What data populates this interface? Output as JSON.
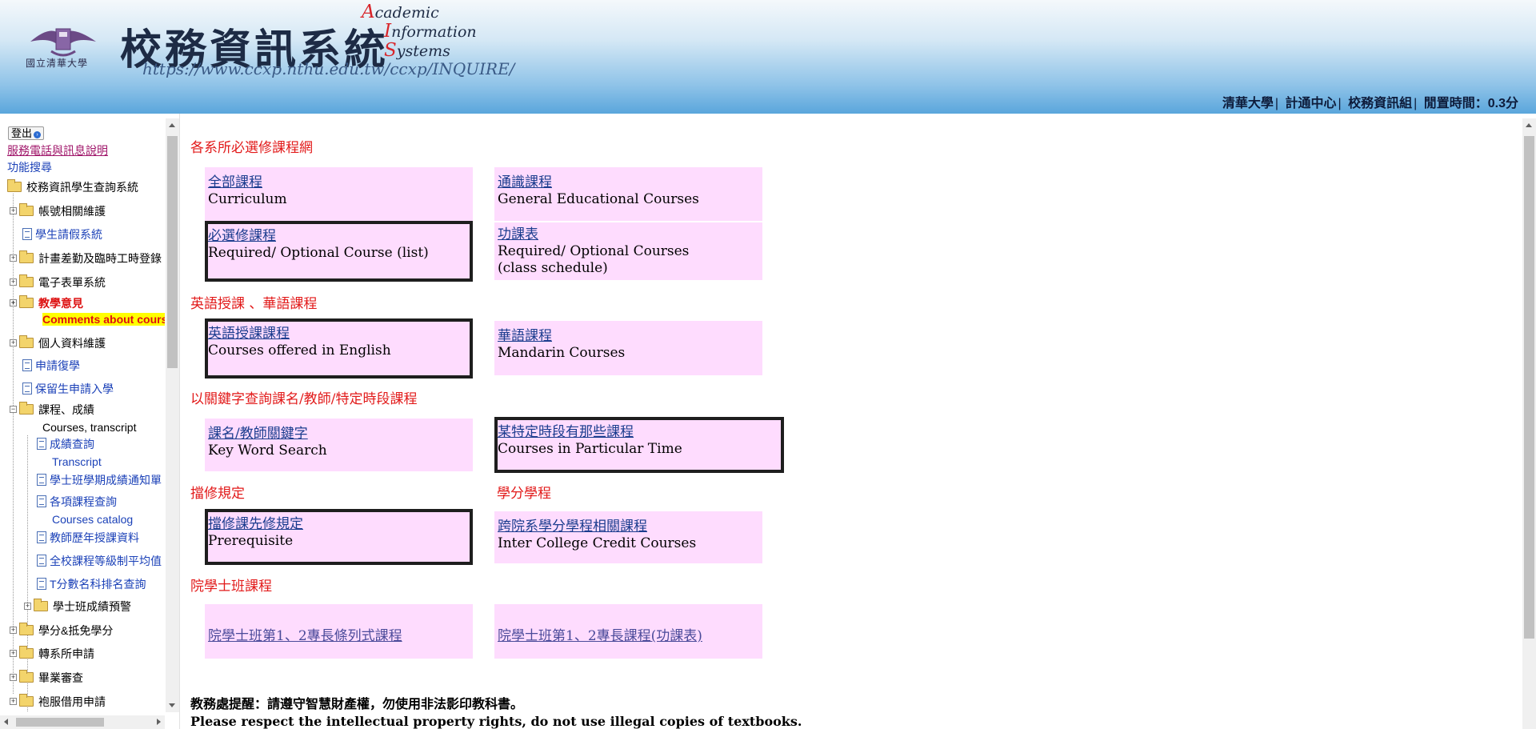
{
  "header": {
    "logo_text": "國立清華大學",
    "title_cn": "校務資訊系統",
    "title_en_lines": [
      {
        "initial": "A",
        "rest": "cademic"
      },
      {
        "initial": "I",
        "rest": "nformation"
      },
      {
        "initial": "S",
        "rest": "ystems"
      }
    ],
    "url": "https://www.ccxp.nthu.edu.tw/ccxp/INQUIRE/",
    "top_links": [
      "清華大學",
      "計通中心",
      "校務資訊組"
    ],
    "idle_label": "閒置時間：0.3分"
  },
  "sidebar": {
    "logout_label": "登出",
    "service_link": "服務電話與訊息說明",
    "search_link": "功能搜尋",
    "root_label": "校務資訊學生查詢系統",
    "items": [
      {
        "label": "帳號相關維護"
      },
      {
        "label": "學生請假系統"
      },
      {
        "label": "計畫差勤及臨時工時登錄"
      },
      {
        "label": "電子表單系統"
      },
      {
        "label": "教學意見",
        "sub": "Comments about courses"
      },
      {
        "label": "個人資料維護"
      },
      {
        "label": "申請復學"
      },
      {
        "label": "保留生申請入學"
      },
      {
        "label": "課程、成績",
        "sub": "Courses, transcript"
      },
      {
        "label": "成績查詢",
        "sub": "Transcript"
      },
      {
        "label": "學士班學期成績通知單"
      },
      {
        "label": "各項課程查詢",
        "sub": "Courses catalog"
      },
      {
        "label": "教師歷年授課資料"
      },
      {
        "label": "全校課程等級制平均值"
      },
      {
        "label": "T分數名科排名查詢"
      },
      {
        "label": "學士班成績預警"
      },
      {
        "label": "學分&抵免學分"
      },
      {
        "label": "轉系所申請"
      },
      {
        "label": "畢業審查"
      },
      {
        "label": "袍服借用申請"
      }
    ]
  },
  "main": {
    "sections": [
      "各系所必選修課程網",
      "英語授課 、華語課程",
      "以關鍵字查詢課名/教師/特定時段課程",
      "擋修規定",
      "學分學程",
      "院學士班課程"
    ],
    "cards": [
      {
        "zh": "全部課程",
        "en": "Curriculum"
      },
      {
        "zh": "通識課程",
        "en": "General Educational Courses"
      },
      {
        "zh": "必選修課程",
        "en": "Required/ Optional Course (list)"
      },
      {
        "zh": "功課表",
        "en": "Required/ Optional Courses (class schedule)"
      },
      {
        "zh": "英語授課課程",
        "en": "Courses offered in English"
      },
      {
        "zh": "華語課程",
        "en": "Mandarin Courses"
      },
      {
        "zh": "課名/教師關鍵字",
        "en": "Key Word Search"
      },
      {
        "zh": "某特定時段有那些課程",
        "en": "Courses in Particular Time"
      },
      {
        "zh": "擋修課先修規定",
        "en": "Prerequisite"
      },
      {
        "zh": "跨院系學分學程相關課程",
        "en": "Inter College Credit Courses"
      },
      {
        "zh": "院學士班第1、2專長條列式課程"
      },
      {
        "zh": "院學士班第1、2專長課程(功課表)"
      }
    ],
    "notice_zh": "教務處提醒：請遵守智慧財產權，勿使用非法影印教科書。",
    "notice_en": "Please respect the intellectual property rights, do not use illegal copies of textbooks."
  }
}
